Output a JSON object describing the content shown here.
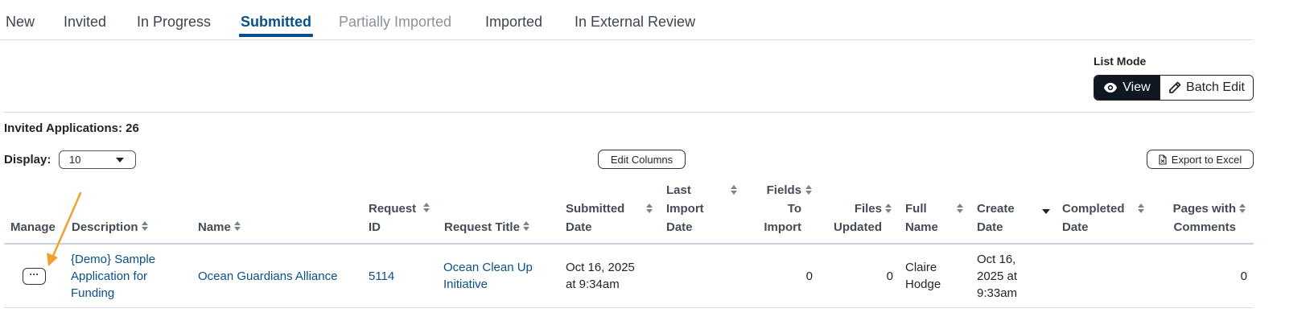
{
  "tabs": [
    {
      "label": "New",
      "state": "normal"
    },
    {
      "label": "Invited",
      "state": "normal"
    },
    {
      "label": "In Progress",
      "state": "normal"
    },
    {
      "label": "Submitted",
      "state": "active"
    },
    {
      "label": "Partially Imported",
      "state": "disabled"
    },
    {
      "label": "Imported",
      "state": "normal"
    },
    {
      "label": "In External Review",
      "state": "normal"
    }
  ],
  "list_mode": {
    "label": "List Mode",
    "view_label": "View",
    "batch_edit_label": "Batch Edit",
    "selected": "View"
  },
  "summary": {
    "count_text": "Invited Applications: 26"
  },
  "display": {
    "label": "Display:",
    "selected": "10"
  },
  "toolbar": {
    "edit_columns_label": "Edit Columns",
    "export_label": "Export to Excel"
  },
  "table": {
    "headers": {
      "manage": "Manage",
      "description": "Description",
      "name": "Name",
      "request_id_1": "Request",
      "request_id_2": "ID",
      "request_title": "Request Title",
      "submitted_date_1": "Submitted",
      "submitted_date_2": "Date",
      "last_import_1": "Last",
      "last_import_2": "Import",
      "last_import_3": "Date",
      "fields_1": "Fields",
      "fields_2": "To",
      "fields_3": "Import",
      "files_1": "Files",
      "files_2": "Updated",
      "full_name_1": "Full",
      "full_name_2": "Name",
      "create_date_1": "Create",
      "create_date_2": "Date",
      "completed_1": "Completed",
      "completed_2": "Date",
      "pages_1": "Pages with",
      "pages_2": "Comments"
    },
    "sorted_column": "Create Date",
    "sort_direction": "descending",
    "rows": [
      {
        "manage_label": "···",
        "description_lines": [
          "{Demo} Sample",
          "Application for",
          "Funding"
        ],
        "name": "Ocean Guardians Alliance",
        "request_id": "5114",
        "request_title_lines": [
          "Ocean Clean Up",
          "Initiative"
        ],
        "submitted_lines": [
          "Oct 16, 2025",
          "at 9:34am"
        ],
        "last_import": "",
        "fields_to_import": "0",
        "files_updated": "0",
        "full_name_lines": [
          "Claire",
          "Hodge"
        ],
        "create_date_lines": [
          "Oct 16,",
          "2025 at",
          "9:33am"
        ],
        "completed_date": "",
        "pages_with_comments": "0"
      }
    ]
  },
  "colors": {
    "accent": "#0b4f8a",
    "annotation_arrow": "#f0a030",
    "active_toggle": "#0f1722"
  }
}
